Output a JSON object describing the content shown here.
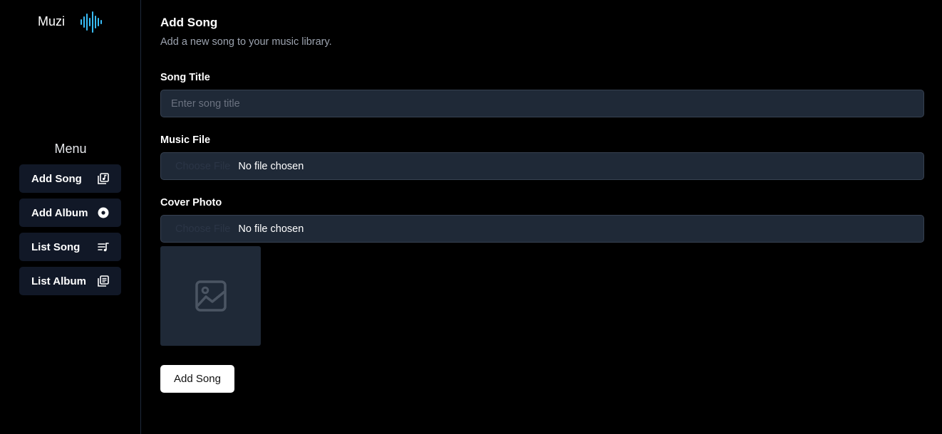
{
  "brand": {
    "name": "Muzi",
    "accent": "#38bdf8",
    "logo_icon": "sound-wave-icon"
  },
  "menu": {
    "title": "Menu",
    "items": [
      {
        "label": "Add Song",
        "icon": "music-note-box-icon"
      },
      {
        "label": "Add Album",
        "icon": "disc-icon"
      },
      {
        "label": "List Song",
        "icon": "playlist-icon"
      },
      {
        "label": "List Album",
        "icon": "library-icon"
      }
    ]
  },
  "page": {
    "title": "Add Song",
    "subtitle": "Add a new song to your music library."
  },
  "form": {
    "song_title": {
      "label": "Song Title",
      "placeholder": "Enter song title",
      "value": ""
    },
    "music_file": {
      "label": "Music File",
      "button": "Choose File",
      "status": "No file chosen"
    },
    "cover_photo": {
      "label": "Cover Photo",
      "button": "Choose File",
      "status": "No file chosen",
      "preview_icon": "image-placeholder-icon"
    },
    "submit_label": "Add Song"
  }
}
